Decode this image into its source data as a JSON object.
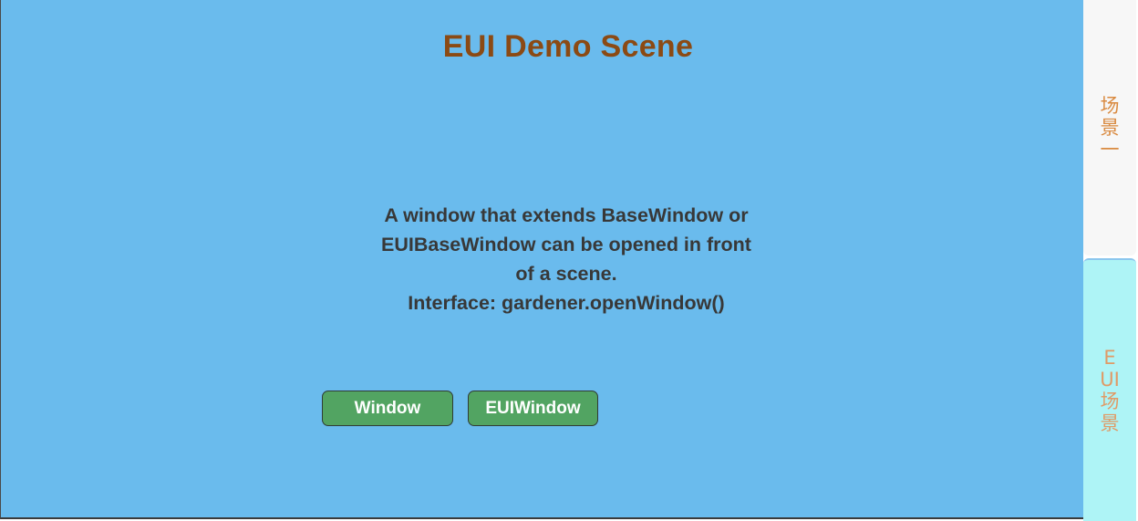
{
  "scene": {
    "title": "EUI Demo Scene",
    "description_lines": [
      "A window that extends BaseWindow or",
      "EUIBaseWindow can be opened in front",
      "of a scene.",
      "Interface: gardener.openWindow()"
    ]
  },
  "buttons": {
    "window_label": "Window",
    "euiwindow_label": "EUIWindow"
  },
  "tabs": [
    {
      "label": "场景一",
      "active": false
    },
    {
      "label": "EUI场景",
      "active": true
    }
  ],
  "colors": {
    "background": "#6abbed",
    "title": "#8b4a14",
    "button": "#52a462",
    "tab_inactive": "#f7f7f7",
    "tab_active": "#aef4f6",
    "tab_text": "#d98a40"
  }
}
